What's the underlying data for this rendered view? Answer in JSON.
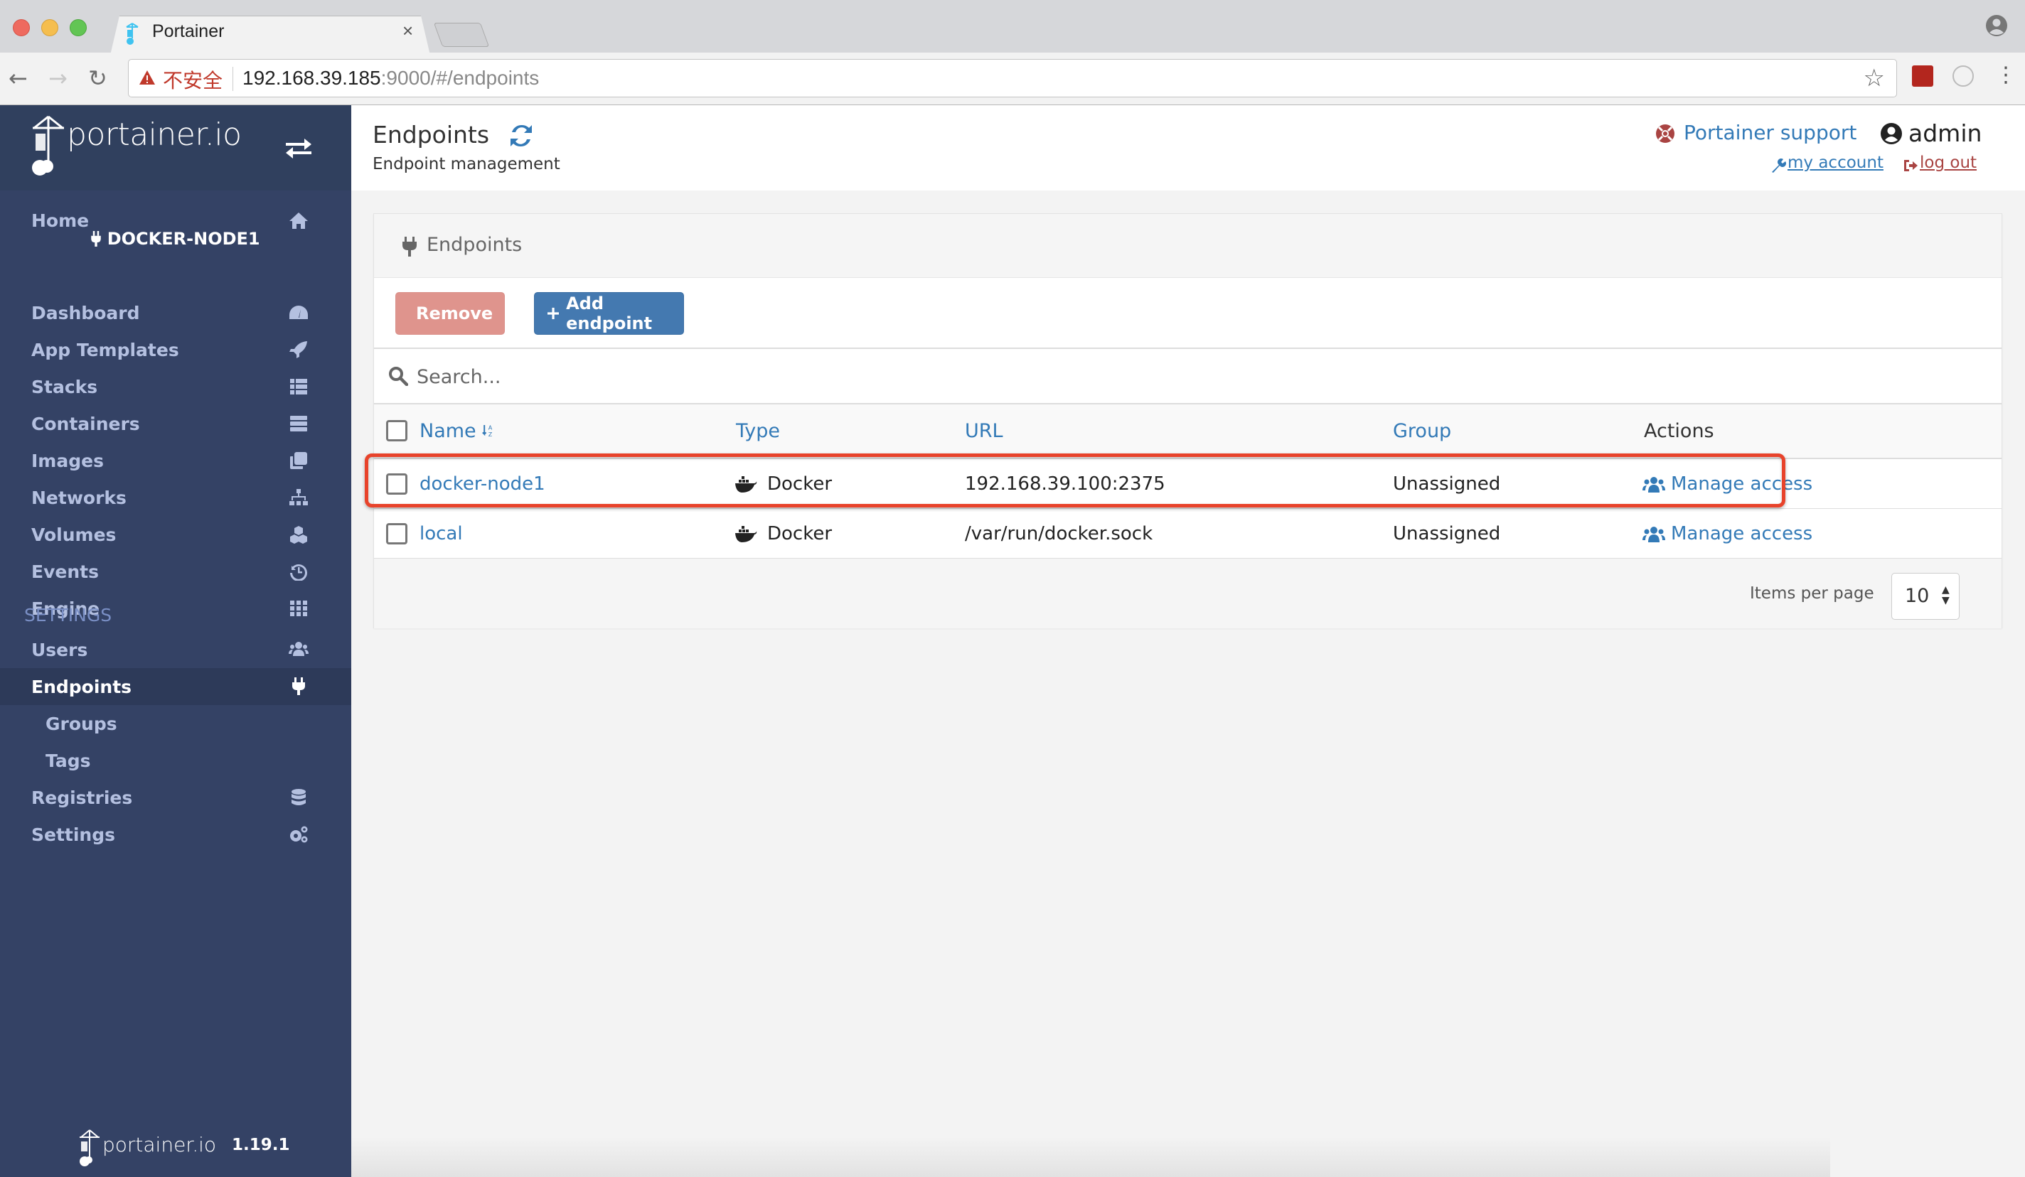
{
  "browser": {
    "tab_title": "Portainer",
    "tab_close": "×",
    "insecure_label": "不安全",
    "url_host": "192.168.39.185",
    "url_rest": ":9000/#/endpoints",
    "icons": [
      "back-arrow-icon",
      "forward-arrow-icon",
      "reload-icon",
      "warning-icon",
      "star-icon",
      "flash-extension-icon",
      "tube-extension-icon",
      "menu-dots-icon",
      "profile-icon"
    ]
  },
  "sidebar": {
    "logo_text": "portainer.io",
    "endpoint_name": "DOCKER-NODE1",
    "home": {
      "label": "Home",
      "icon": "home-icon"
    },
    "items": [
      {
        "label": "Dashboard",
        "icon": "dashboard-icon"
      },
      {
        "label": "App Templates",
        "icon": "rocket-icon"
      },
      {
        "label": "Stacks",
        "icon": "list-icon"
      },
      {
        "label": "Containers",
        "icon": "server-icon"
      },
      {
        "label": "Images",
        "icon": "clone-icon"
      },
      {
        "label": "Networks",
        "icon": "sitemap-icon"
      },
      {
        "label": "Volumes",
        "icon": "cubes-icon"
      },
      {
        "label": "Events",
        "icon": "history-icon"
      },
      {
        "label": "Engine",
        "icon": "th-icon"
      }
    ],
    "section_title": "SETTINGS",
    "settings_items": [
      {
        "label": "Users",
        "icon": "users-icon",
        "active": false
      },
      {
        "label": "Endpoints",
        "icon": "plug-icon",
        "active": true
      },
      {
        "label": "Groups",
        "sub": true
      },
      {
        "label": "Tags",
        "sub": true
      },
      {
        "label": "Registries",
        "icon": "database-icon",
        "active": false
      },
      {
        "label": "Settings",
        "icon": "cogs-icon",
        "active": false
      }
    ],
    "footer_logo": "portainer.io",
    "version": "1.19.1"
  },
  "header": {
    "title": "Endpoints",
    "subtitle": "Endpoint management",
    "support_label": "Portainer support",
    "username": "admin",
    "my_account": " my account ",
    "log_out": " log out"
  },
  "widget": {
    "title": "Endpoints",
    "remove_label": "Remove",
    "add_label": "Add endpoint",
    "search_placeholder": "Search...",
    "columns": {
      "name": "Name",
      "type": "Type",
      "url": "URL",
      "group": "Group",
      "actions": "Actions"
    },
    "rows": [
      {
        "name": "docker-node1",
        "type": "Docker",
        "url": "192.168.39.100:2375",
        "group": "Unassigned",
        "action": "Manage access",
        "highlighted": true
      },
      {
        "name": "local",
        "type": "Docker",
        "url": "/var/run/docker.sock",
        "group": "Unassigned",
        "action": "Manage access",
        "highlighted": false
      }
    ],
    "items_per_page_label": "Items per page",
    "items_per_page_value": "10"
  },
  "colors": {
    "sidebar_bg": "#344265",
    "link_blue": "#337ab7",
    "danger": "#a94442",
    "highlight_red": "#e8432b",
    "remove_btn": "#df948d",
    "add_btn": "#4479b0"
  }
}
